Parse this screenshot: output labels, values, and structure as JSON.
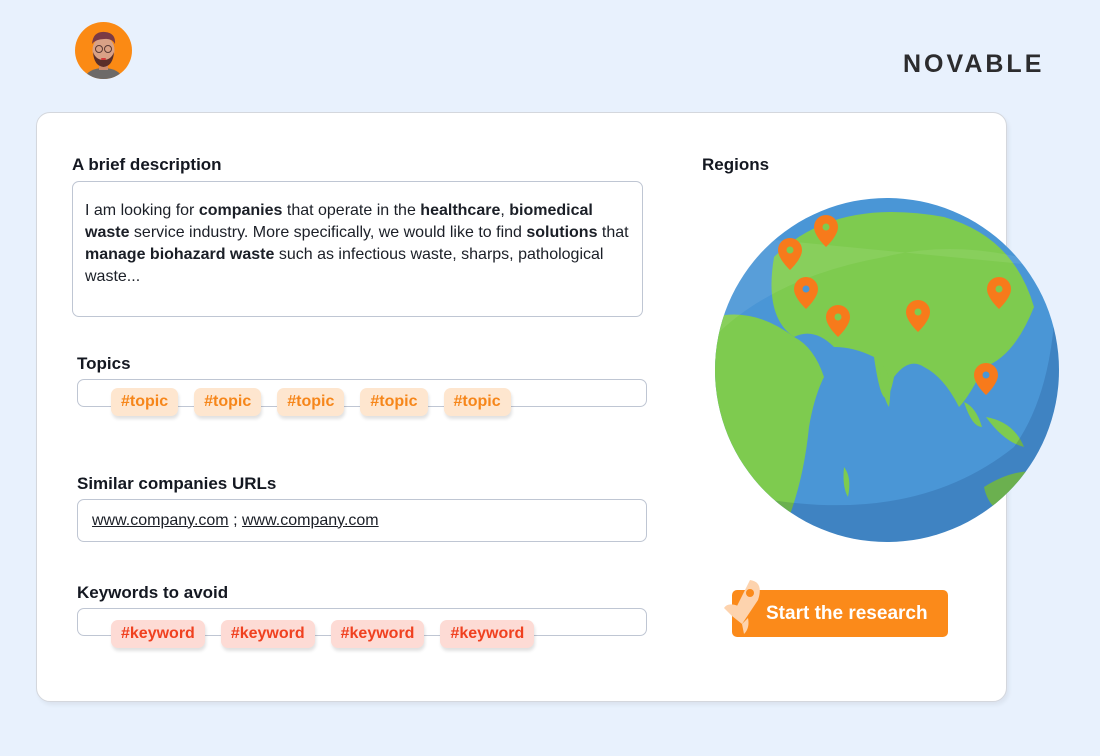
{
  "header": {
    "avatar_icon": "user-avatar-icon",
    "logo_text": "NOVABLE"
  },
  "form": {
    "description": {
      "label": "A brief description",
      "segments": [
        {
          "text": "I am looking for ",
          "bold": false
        },
        {
          "text": "companies",
          "bold": true
        },
        {
          "text": " that operate in the ",
          "bold": false
        },
        {
          "text": "healthcare",
          "bold": true
        },
        {
          "text": ", ",
          "bold": false
        },
        {
          "text": "biomedical waste",
          "bold": true
        },
        {
          "text": " service industry. More specifically, we would like to find ",
          "bold": false
        },
        {
          "text": "solutions",
          "bold": true
        },
        {
          "text": " that ",
          "bold": false
        },
        {
          "text": "manage biohazard waste",
          "bold": true
        },
        {
          "text": " such as infectious waste, sharps, pathological waste...",
          "bold": false
        }
      ]
    },
    "topics": {
      "label": "Topics",
      "tags": [
        "#topic",
        "#topic",
        "#topic",
        "#topic",
        "#topic"
      ]
    },
    "similar_urls": {
      "label": "Similar companies URLs",
      "urls": [
        "www.company.com",
        "www.company.com"
      ],
      "separator": " ; "
    },
    "keywords_avoid": {
      "label": "Keywords to avoid",
      "tags": [
        "#keyword",
        "#keyword",
        "#keyword",
        "#keyword"
      ]
    }
  },
  "regions": {
    "label": "Regions",
    "pins": [
      "Western Europe",
      "Northern Europe",
      "Eastern Mediterranean",
      "Arabian Peninsula",
      "India",
      "China",
      "Southeast Asia"
    ]
  },
  "actions": {
    "start_label": "Start the research",
    "start_icon": "rocket-icon"
  },
  "colors": {
    "accent": "#fb8a1a",
    "topic_bg": "#fee6cf",
    "topic_text": "#f6861a",
    "keyword_bg": "#fddbd5",
    "keyword_text": "#f0401f",
    "page_bg": "#e8f1fd"
  }
}
